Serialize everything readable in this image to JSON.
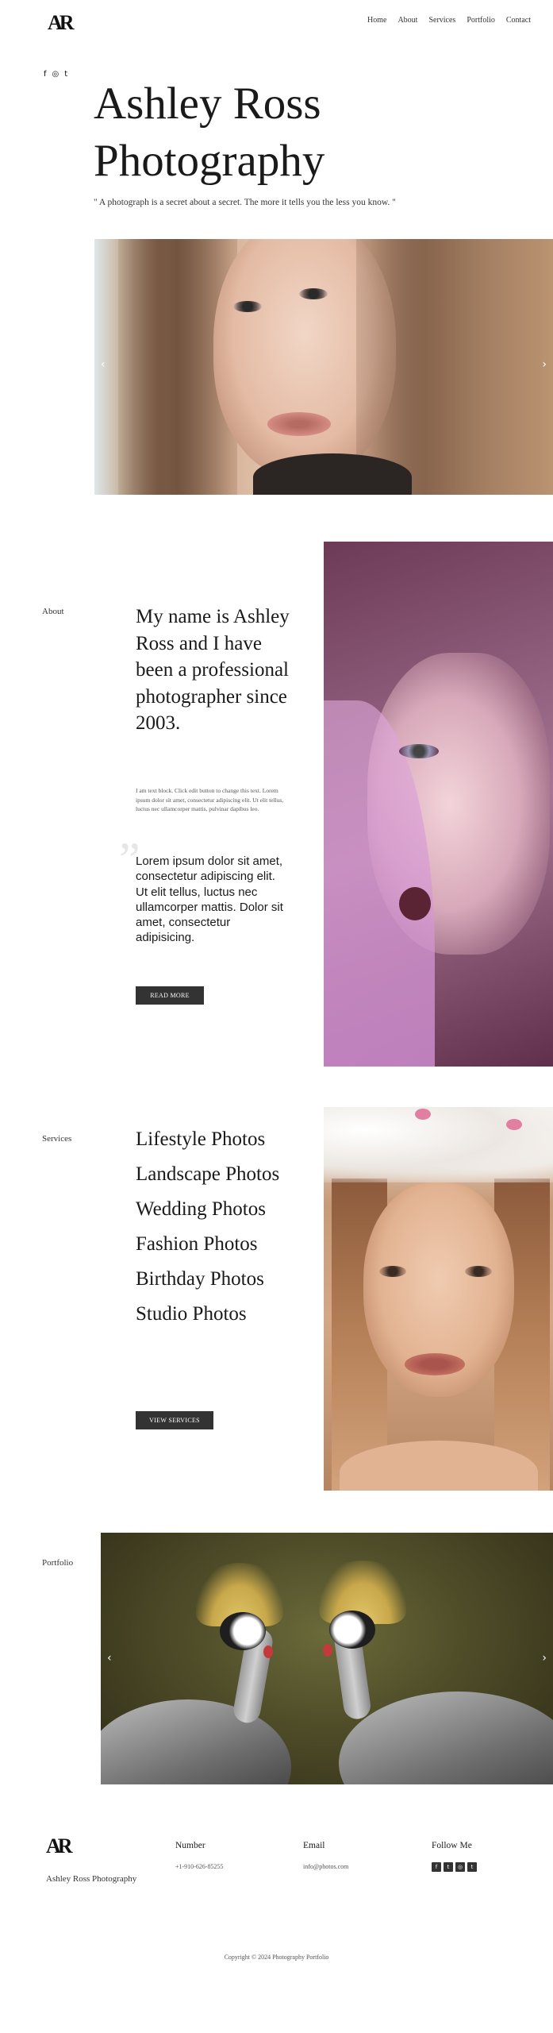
{
  "header": {
    "logo": "AR",
    "nav": [
      "Home",
      "About",
      "Services",
      "Portfolio",
      "Contact"
    ]
  },
  "social_top": {
    "icons": [
      "facebook-icon",
      "instagram-icon",
      "tumblr-icon"
    ],
    "glyphs": [
      "f",
      "◎",
      "t"
    ]
  },
  "hero": {
    "title_line1": "Ashley Ross",
    "title_line2": "Photography",
    "quote": "\" A photograph is a secret about a secret. The more it tells you the less you know. \"",
    "prev_arrow": "‹",
    "next_arrow": "›"
  },
  "about": {
    "label": "About",
    "heading": "My name is Ashley Ross and I have been a professional photographer since 2003.",
    "body": "I am text block. Click edit button to change this text. Lorem ipsum dolor sit amet, consectetur adipiscing elit. Ut elit tellus, luctus nec ullamcorper mattis, pulvinar dapibus leo.",
    "quote_mark": "”",
    "quote": "Lorem ipsum dolor sit amet, consectetur adipiscing elit. Ut elit tellus, luctus nec ullamcorper mattis. Dolor sit amet, consectetur adipisicing.",
    "button": "READ MORE"
  },
  "services": {
    "label": "Services",
    "items": [
      "Lifestyle Photos",
      "Landscape Photos",
      "Wedding Photos",
      "Fashion Photos",
      "Birthday Photos",
      "Studio Photos"
    ],
    "button": "VIEW SERVICES"
  },
  "portfolio": {
    "label": "Portfolio",
    "prev_arrow": "‹",
    "next_arrow": "›"
  },
  "footer": {
    "logo": "AR",
    "tagline": "Ashley Ross Photography",
    "number_title": "Number",
    "number_value": "+1-910-626-85255",
    "email_title": "Email",
    "email_value": "info@photos.com",
    "follow_title": "Follow Me",
    "social_icons": [
      "facebook-icon",
      "twitter-icon",
      "instagram-icon",
      "tumblr-icon"
    ],
    "social_glyphs": [
      "f",
      "t",
      "◎",
      "t"
    ],
    "copyright": "Copyright © 2024 Photography Portfolio"
  }
}
